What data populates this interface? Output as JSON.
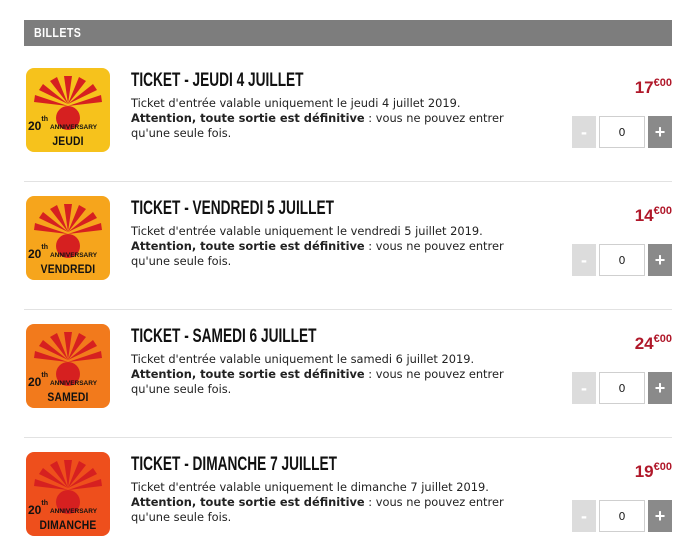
{
  "header": {
    "title": "BILLETS"
  },
  "badge_text": {
    "number": "20",
    "suffix": "th",
    "anniversary": "ANNIVERSARY"
  },
  "colors": {
    "price": "#b0182a",
    "header_bg": "#7d7d7d",
    "sun": "#d62020"
  },
  "tickets": [
    {
      "title": "TICKET - JEUDI 4 JUILLET",
      "desc_line": "Ticket d'entrée valable uniquement le jeudi 4 juillet 2019.",
      "warn_strong": "Attention, toute sortie est définitive",
      "warn_rest": " : vous ne pouvez entrer qu'une seule fois.",
      "price_main": "17",
      "price_cents": "€00",
      "quantity": "0",
      "minus_label": "-",
      "plus_label": "+",
      "badge_day": "JEUDI",
      "badge_color": "#f6c21c"
    },
    {
      "title": "TICKET - VENDREDI 5 JUILLET",
      "desc_line": "Ticket d'entrée valable uniquement le vendredi 5 juillet 2019.",
      "warn_strong": "Attention, toute sortie est définitive",
      "warn_rest": " : vous ne pouvez entrer qu'une seule fois.",
      "price_main": "14",
      "price_cents": "€00",
      "quantity": "0",
      "minus_label": "-",
      "plus_label": "+",
      "badge_day": "VENDREDI",
      "badge_color": "#f6a51c"
    },
    {
      "title": "TICKET - SAMEDI 6 JUILLET",
      "desc_line": "Ticket d'entrée valable uniquement le samedi 6 juillet 2019.",
      "warn_strong": "Attention, toute sortie est définitive",
      "warn_rest": " : vous ne pouvez entrer qu'une seule fois.",
      "price_main": "24",
      "price_cents": "€00",
      "quantity": "0",
      "minus_label": "-",
      "plus_label": "+",
      "badge_day": "SAMEDI",
      "badge_color": "#f27a1c"
    },
    {
      "title": "TICKET - DIMANCHE 7 JUILLET",
      "desc_line": "Ticket d'entrée valable uniquement le dimanche 7 juillet 2019.",
      "warn_strong": "Attention, toute sortie est définitive",
      "warn_rest": " : vous ne pouvez entrer qu'une seule fois.",
      "price_main": "19",
      "price_cents": "€00",
      "quantity": "0",
      "minus_label": "-",
      "plus_label": "+",
      "badge_day": "DIMANCHE",
      "badge_color": "#ee4f1c"
    }
  ]
}
